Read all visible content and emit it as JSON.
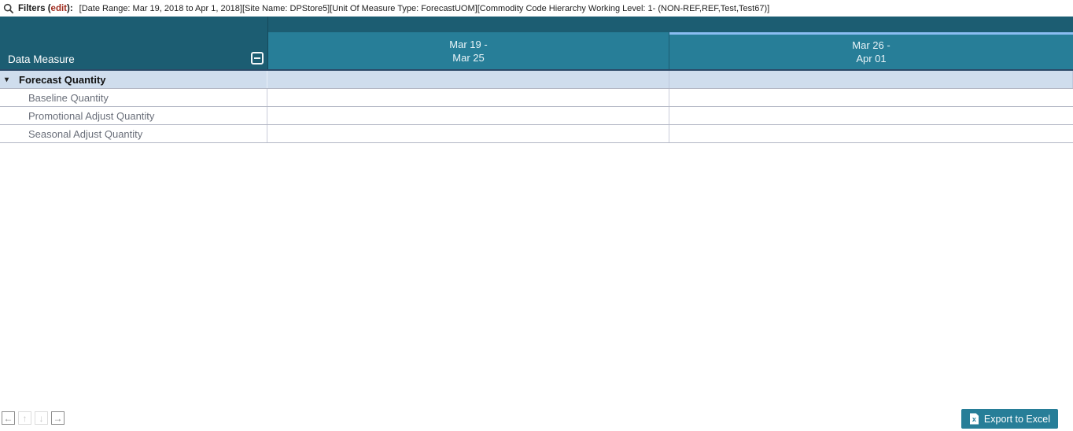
{
  "filter_bar": {
    "label_prefix": "Filters (",
    "edit_label": "edit",
    "label_suffix": "):",
    "filters_text": "[Date Range: Mar 19, 2018 to Apr 1, 2018][Site Name: DPStore5][Unit Of Measure Type: ForecastUOM][Commodity Code Hierarchy Working Level: 1- (NON-REF,REF,Test,Test67)]"
  },
  "grid": {
    "corner_title": "Data Measure",
    "columns": [
      {
        "line1": "Mar 19 -",
        "line2": "Mar 25",
        "selected": false
      },
      {
        "line1": "Mar 26 -",
        "line2": "Apr 01",
        "selected": true
      }
    ],
    "rows": [
      {
        "label": "Forecast Quantity",
        "level": 0,
        "expanded": true,
        "cells": [
          "",
          ""
        ]
      },
      {
        "label": "Baseline Quantity",
        "level": 1,
        "cells": [
          "",
          ""
        ]
      },
      {
        "label": "Promotional Adjust Quantity",
        "level": 1,
        "cells": [
          "",
          ""
        ]
      },
      {
        "label": "Seasonal Adjust Quantity",
        "level": 1,
        "cells": [
          "",
          ""
        ]
      }
    ]
  },
  "icons": {
    "expanded_caret": "▾",
    "nav_left": "←",
    "nav_up": "↑",
    "nav_down": "↓",
    "nav_right": "→"
  },
  "footer": {
    "nav": [
      {
        "glyph_key": "nav_left",
        "enabled": true
      },
      {
        "glyph_key": "nav_up",
        "enabled": false
      },
      {
        "glyph_key": "nav_down",
        "enabled": false
      },
      {
        "glyph_key": "nav_right",
        "enabled": true
      }
    ],
    "export_label": "Export to Excel"
  },
  "colors": {
    "header_dark_teal": "#1c5d72",
    "header_light_teal": "#277e98",
    "selected_column_border": "#8bbdf2",
    "parent_row_bg": "#cfdded",
    "row_border": "#b2b6c4",
    "edit_link": "#9e2a1d",
    "export_button_bg": "#277e98"
  }
}
